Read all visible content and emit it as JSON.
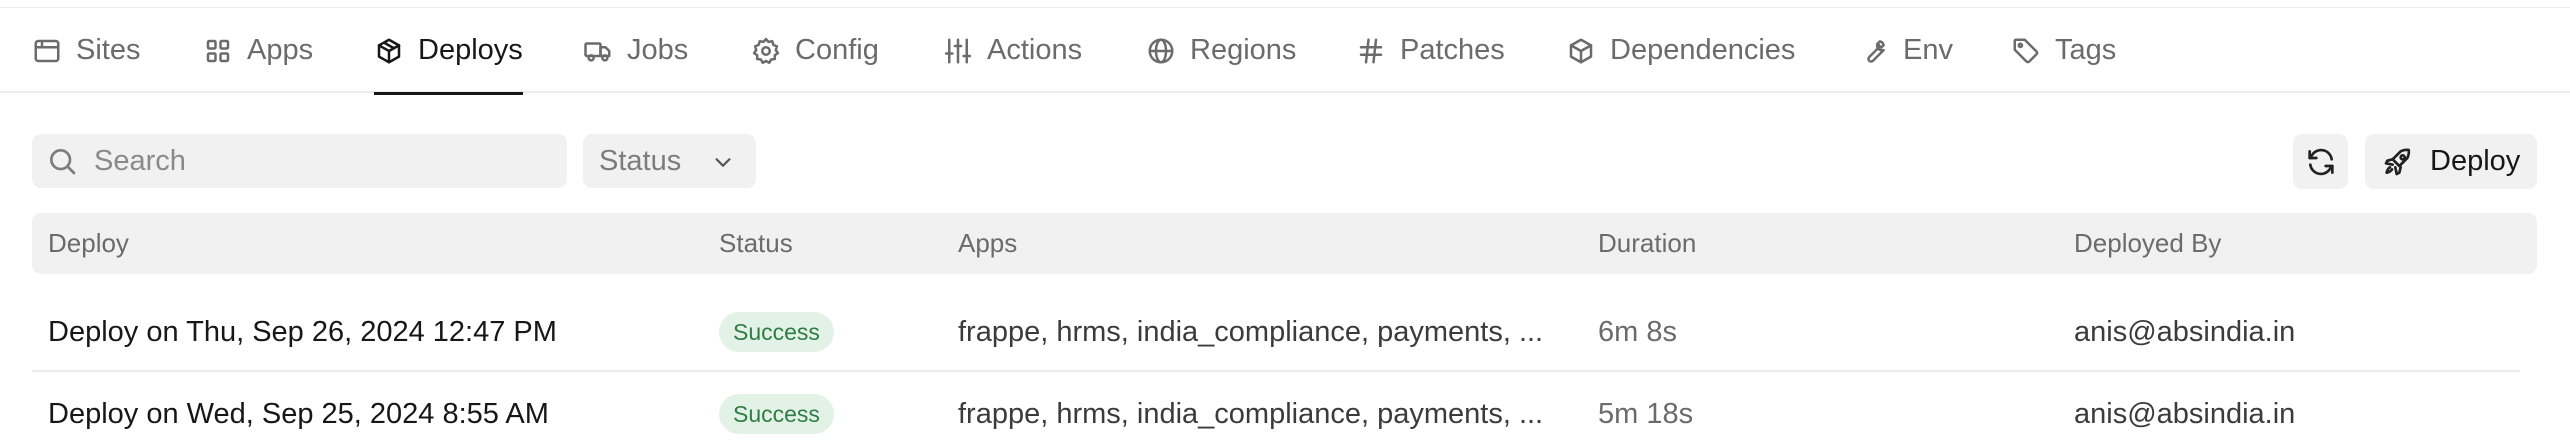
{
  "tabs": [
    {
      "label": "Sites",
      "icon": "browser-window-icon",
      "active": false
    },
    {
      "label": "Apps",
      "icon": "grid-icon",
      "active": false
    },
    {
      "label": "Deploys",
      "icon": "package-icon",
      "active": true
    },
    {
      "label": "Jobs",
      "icon": "truck-icon",
      "active": false
    },
    {
      "label": "Config",
      "icon": "gear-icon",
      "active": false
    },
    {
      "label": "Actions",
      "icon": "sliders-icon",
      "active": false
    },
    {
      "label": "Regions",
      "icon": "globe-icon",
      "active": false
    },
    {
      "label": "Patches",
      "icon": "hash-icon",
      "active": false
    },
    {
      "label": "Dependencies",
      "icon": "package-icon",
      "active": false
    },
    {
      "label": "Env",
      "icon": "wrench-icon",
      "active": false
    },
    {
      "label": "Tags",
      "icon": "tag-icon",
      "active": false
    }
  ],
  "toolbar": {
    "search_placeholder": "Search",
    "search_value": "",
    "status_filter_label": "Status",
    "deploy_button_label": "Deploy"
  },
  "table": {
    "columns": [
      "Deploy",
      "Status",
      "Apps",
      "Duration",
      "Deployed By"
    ],
    "rows": [
      {
        "deploy": "Deploy on Thu, Sep 26, 2024 12:47 PM",
        "status": "Success",
        "apps": "frappe, hrms, india_compliance, payments, ...",
        "duration": "6m 8s",
        "deployed_by": "anis@absindia.in"
      },
      {
        "deploy": "Deploy on Wed, Sep 25, 2024 8:55 AM",
        "status": "Success",
        "apps": "frappe, hrms, india_compliance, payments, ...",
        "duration": "5m 18s",
        "deployed_by": "anis@absindia.in"
      }
    ]
  },
  "colors": {
    "success_badge_bg": "#e3f2e6",
    "success_badge_text": "#2f7d45",
    "muted_text": "#6b6b6b",
    "control_bg": "#f1f1f1"
  }
}
